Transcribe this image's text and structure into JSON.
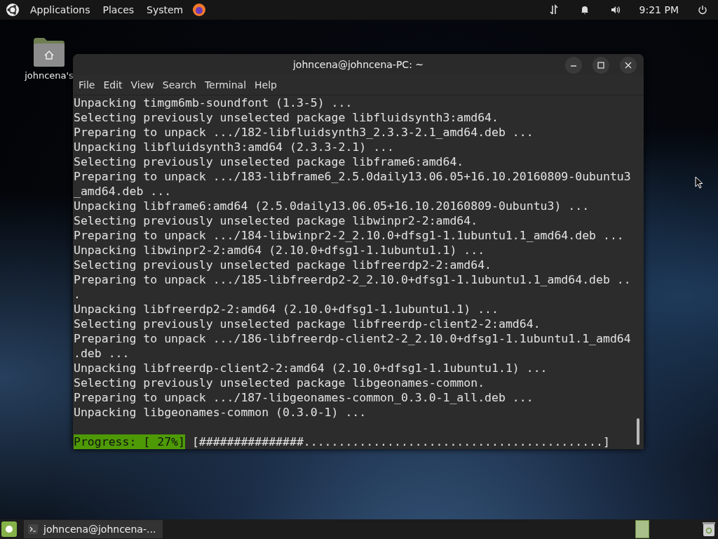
{
  "top_panel": {
    "menus": [
      "Applications",
      "Places",
      "System"
    ],
    "clock": "9:21 PM"
  },
  "desktop_icons": [
    {
      "label": "johncena's"
    }
  ],
  "terminal": {
    "title": "johncena@johncena-PC: ~",
    "menu": [
      "File",
      "Edit",
      "View",
      "Search",
      "Terminal",
      "Help"
    ],
    "lines": [
      "Unpacking timgm6mb-soundfont (1.3-5) ...",
      "Selecting previously unselected package libfluidsynth3:amd64.",
      "Preparing to unpack .../182-libfluidsynth3_2.3.3-2.1_amd64.deb ...",
      "Unpacking libfluidsynth3:amd64 (2.3.3-2.1) ...",
      "Selecting previously unselected package libframe6:amd64.",
      "Preparing to unpack .../183-libframe6_2.5.0daily13.06.05+16.10.20160809-0ubuntu3_amd64.deb ...",
      "Unpacking libframe6:amd64 (2.5.0daily13.06.05+16.10.20160809-0ubuntu3) ...",
      "Selecting previously unselected package libwinpr2-2:amd64.",
      "Preparing to unpack .../184-libwinpr2-2_2.10.0+dfsg1-1.1ubuntu1.1_amd64.deb ...",
      "Unpacking libwinpr2-2:amd64 (2.10.0+dfsg1-1.1ubuntu1.1) ...",
      "Selecting previously unselected package libfreerdp2-2:amd64.",
      "Preparing to unpack .../185-libfreerdp2-2_2.10.0+dfsg1-1.1ubuntu1.1_amd64.deb ...",
      "Unpacking libfreerdp2-2:amd64 (2.10.0+dfsg1-1.1ubuntu1.1) ...",
      "Selecting previously unselected package libfreerdp-client2-2:amd64.",
      "Preparing to unpack .../186-libfreerdp-client2-2_2.10.0+dfsg1-1.1ubuntu1.1_amd64.deb ...",
      "Unpacking libfreerdp-client2-2:amd64 (2.10.0+dfsg1-1.1ubuntu1.1) ...",
      "Selecting previously unselected package libgeonames-common.",
      "Preparing to unpack .../187-libgeonames-common_0.3.0-1_all.deb ...",
      "Unpacking libgeonames-common (0.3.0-1) ..."
    ],
    "progress": {
      "label": "Progress: [ 27%]",
      "bar": "[###############...........................................]"
    }
  },
  "taskbar": {
    "items": [
      {
        "label": "johncena@johncena-...",
        "selected": true
      }
    ]
  }
}
